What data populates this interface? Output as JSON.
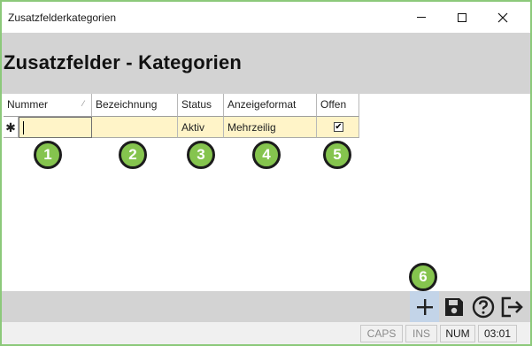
{
  "window": {
    "title": "Zusatzfelderkategorien",
    "heading": "Zusatzfelder - Kategorien"
  },
  "grid": {
    "columns": [
      "Nummer",
      "Bezeichnung",
      "Status",
      "Anzeigeformat",
      "Offen"
    ],
    "new_row_marker": "✱",
    "new_row": {
      "nummer": "",
      "bezeichnung": "",
      "status": "Aktiv",
      "anzeigeformat": "Mehrzeilig",
      "offen_checked": true
    }
  },
  "callouts": [
    "1",
    "2",
    "3",
    "4",
    "5",
    "6"
  ],
  "toolbar": {
    "buttons": [
      "add-icon",
      "save-icon",
      "help-icon",
      "exit-icon"
    ]
  },
  "statusbar": {
    "caps": "CAPS",
    "ins": "INS",
    "num": "NUM",
    "time": "03:01"
  },
  "colors": {
    "callout_fill": "#85c44e",
    "frame_border": "#8cc97a",
    "row_highlight": "#fff4c8",
    "header_band": "#d3d3d3",
    "add_button_highlight": "#c3d4e8"
  }
}
